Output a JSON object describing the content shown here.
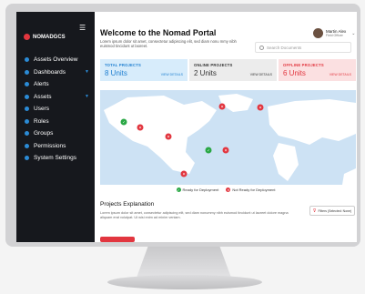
{
  "brand": {
    "name": "NOMADGCS"
  },
  "sidebar": {
    "items": [
      {
        "label": "Assets Overview",
        "icon": "grid-icon",
        "chevron": false
      },
      {
        "label": "Dashboards",
        "icon": "dashboard-icon",
        "chevron": true
      },
      {
        "label": "Alerts",
        "icon": "bell-icon",
        "chevron": false
      },
      {
        "label": "Assets",
        "icon": "box-icon",
        "chevron": true
      },
      {
        "label": "Users",
        "icon": "user-icon",
        "chevron": false
      },
      {
        "label": "Roles",
        "icon": "role-icon",
        "chevron": false
      },
      {
        "label": "Groups",
        "icon": "groups-icon",
        "chevron": false
      },
      {
        "label": "Permissions",
        "icon": "lock-icon",
        "chevron": false
      },
      {
        "label": "System Settings",
        "icon": "gear-icon",
        "chevron": false
      }
    ]
  },
  "header": {
    "title": "Welcome to the Nomad Portal",
    "description": "Lorem ipsum dolor sit amet, consectetur adipiscing elit, sed diam nonu mmy nibh euismod tincidunt ut laoreet.",
    "search_placeholder": "Search Documents",
    "user_name": "Martin Alex",
    "user_role": "Field Officer"
  },
  "stats": [
    {
      "label": "TOTAL PROJECTS",
      "value": "8 Units",
      "link": "VIEW DETAILS",
      "bg": "#d7ecfb",
      "color": "#1f7fd0"
    },
    {
      "label": "ONLINE PROJECTS",
      "value": "2 Units",
      "link": "VIEW DETAILS",
      "bg": "#ececec",
      "color": "#333333"
    },
    {
      "label": "OFFLINE PROJECTS",
      "value": "6 Units",
      "link": "VIEW DETAILS",
      "bg": "#fbe0e1",
      "color": "#e2363f"
    }
  ],
  "legend": {
    "ready": "Ready for Deployment",
    "not_ready": "Not Ready for Deployment",
    "ready_color": "#2aa845",
    "not_ready_color": "#e2363f"
  },
  "projects": {
    "title": "Projects Explanation",
    "description": "Lorem ipsum dolor sit amet, consectetur adipiscing elit, sed diam nonummy nibh euismod tincidunt ut laoreet dolore magna aliquam erat volutpat. Ut wisi enim ad minim veniam.",
    "filter_label": "Filters (Selected: None)"
  }
}
